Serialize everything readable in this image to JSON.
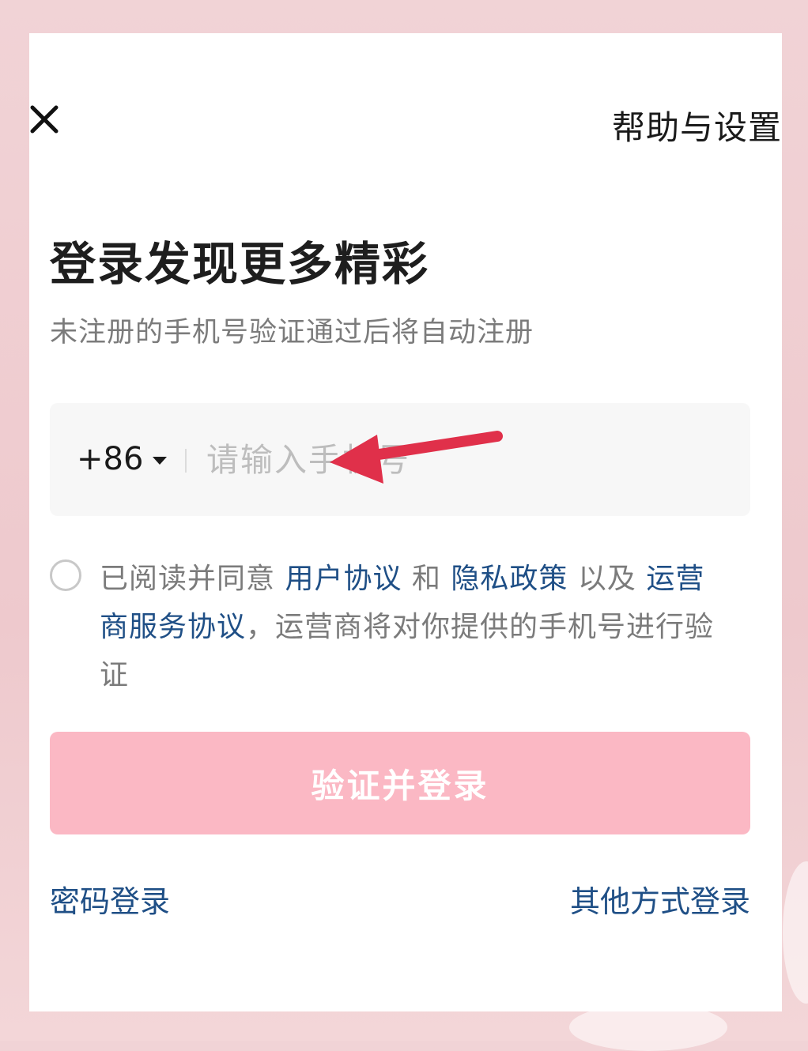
{
  "header": {
    "close_icon": "close-icon",
    "help_label": "帮助与设置"
  },
  "title": "登录发现更多精彩",
  "subtitle": "未注册的手机号验证通过后将自动注册",
  "phone": {
    "country_code": "+86",
    "placeholder": "请输入手机号",
    "value": ""
  },
  "agreement": {
    "prefix": "已阅读并同意",
    "user_agreement": "用户协议",
    "and": "和",
    "privacy_policy": "隐私政策",
    "as_well_as": "以及",
    "carrier_agreement": "运营商服务协议",
    "suffix": "，运营商将对你提供的手机号进行验证"
  },
  "login_button": "验证并登录",
  "footer": {
    "password_login": "密码登录",
    "other_login": "其他方式登录"
  },
  "colors": {
    "accent_link": "#1f4f86",
    "login_button": "#fbb8c4",
    "annotation_arrow": "#e0304a"
  }
}
